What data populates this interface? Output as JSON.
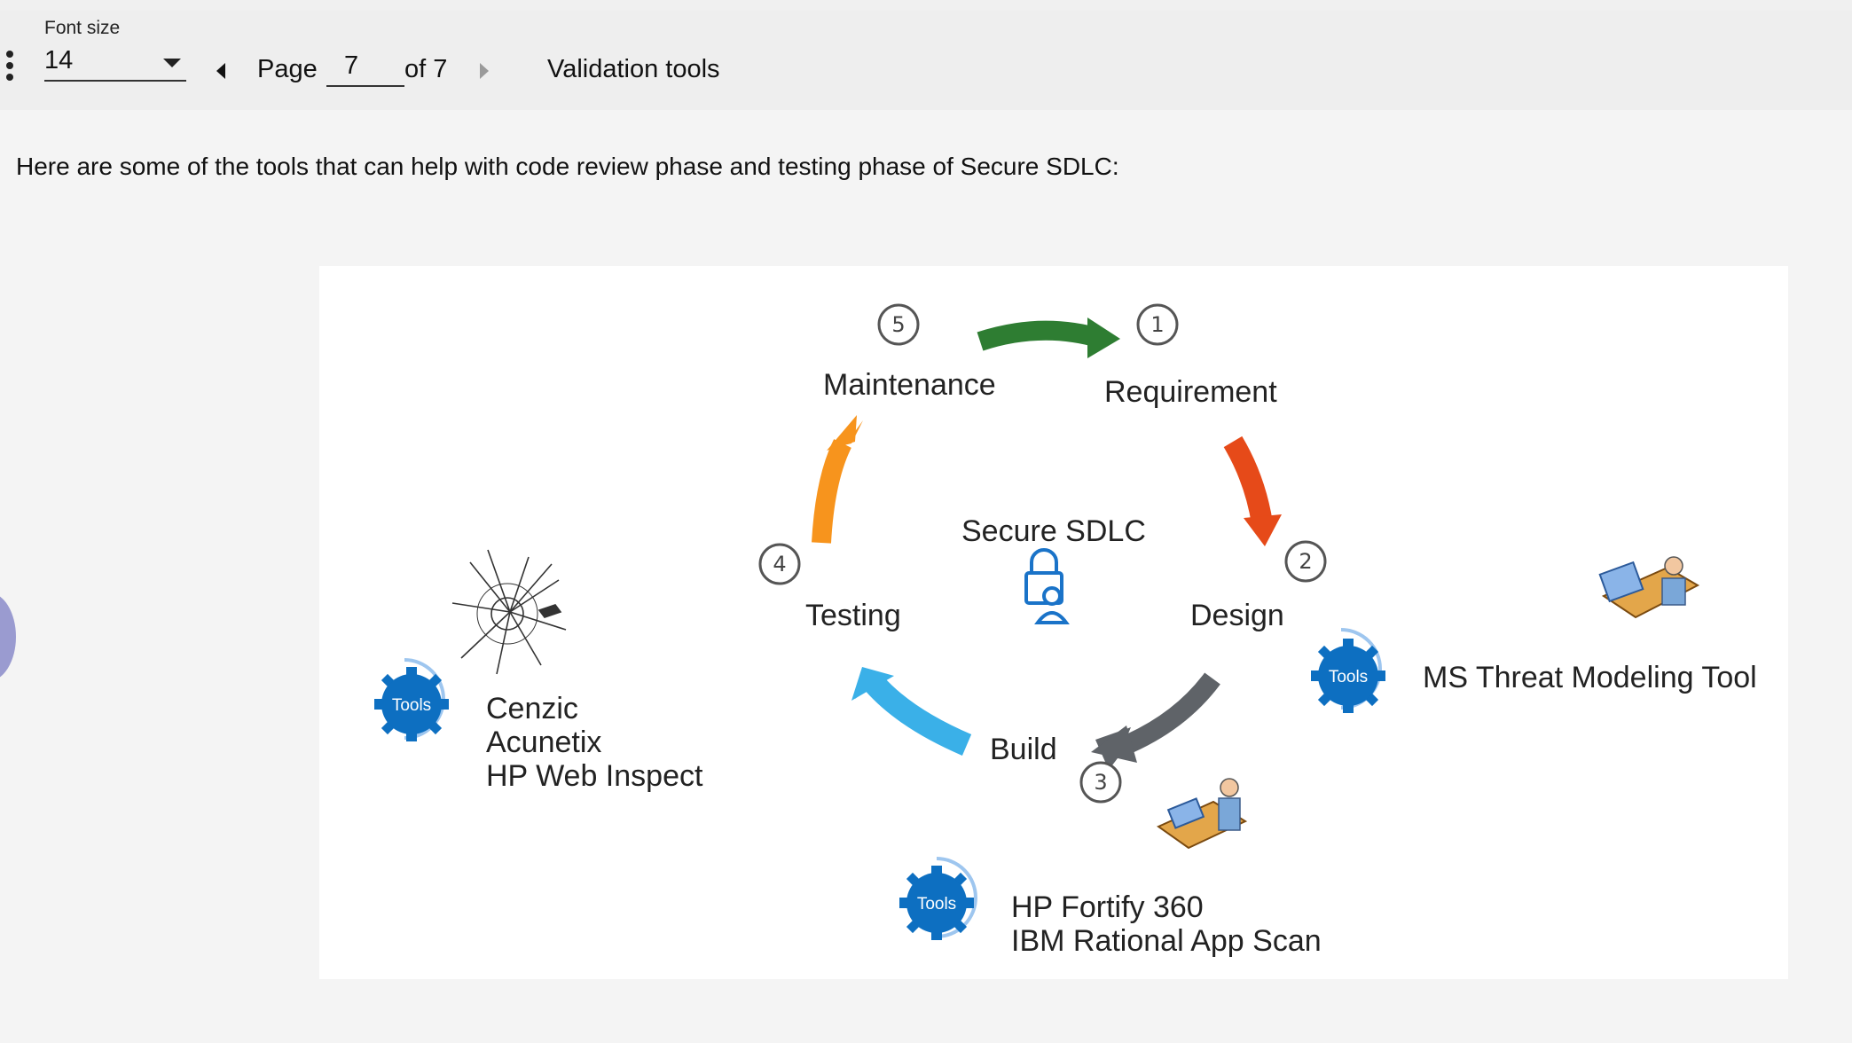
{
  "toolbar": {
    "font_size_label": "Font size",
    "font_size_value": "14",
    "page_word": "Page",
    "current_page": "7",
    "page_of": "of 7",
    "doc_title": "Validation tools"
  },
  "content": {
    "intro": "Here are some of the tools that can help with code review phase and testing phase of Secure SDLC:"
  },
  "diagram": {
    "center_title": "Secure SDLC",
    "phases": [
      {
        "number": "1",
        "label": "Requirement",
        "arrow_color": "#2e7d32"
      },
      {
        "number": "2",
        "label": "Design",
        "arrow_color": "#e64a19"
      },
      {
        "number": "3",
        "label": "Build",
        "arrow_color": "#5f6368"
      },
      {
        "number": "4",
        "label": "Testing",
        "arrow_color": "#3ab0e8"
      },
      {
        "number": "5",
        "label": "Maintenance",
        "arrow_color": "#f7941d"
      }
    ],
    "tools_badge": "Tools",
    "tool_groups": {
      "design": [
        "MS Threat Modeling Tool"
      ],
      "build": [
        "HP Fortify 360",
        "IBM Rational App Scan"
      ],
      "testing": [
        "Cenzic",
        "Acunetix",
        "HP Web Inspect"
      ]
    },
    "colors": {
      "tools_badge": "#0d6fc1",
      "lock_icon": "#1a73c8"
    }
  }
}
